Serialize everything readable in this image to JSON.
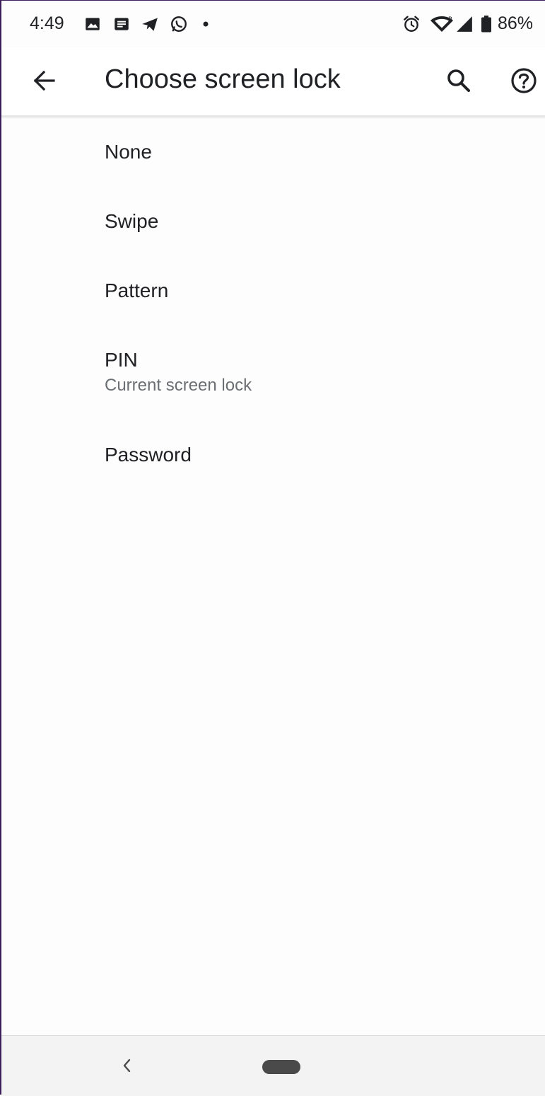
{
  "status_bar": {
    "time": "4:49",
    "battery_percent": "86%",
    "left_icons": [
      "image-icon",
      "message-icon",
      "telegram-icon",
      "whatsapp-icon",
      "dot-icon"
    ],
    "right_icons": [
      "alarm-icon",
      "wifi-icon",
      "signal-icon",
      "battery-icon"
    ]
  },
  "app_bar": {
    "title": "Choose screen lock",
    "back_icon": "back-arrow-icon",
    "search_icon": "search-icon",
    "help_icon": "help-icon"
  },
  "options": [
    {
      "title": "None"
    },
    {
      "title": "Swipe"
    },
    {
      "title": "Pattern"
    },
    {
      "title": "PIN",
      "summary": "Current screen lock"
    },
    {
      "title": "Password"
    }
  ],
  "nav_bar": {
    "back_icon": "nav-back-icon",
    "home_icon": "nav-home-pill"
  },
  "colors": {
    "background": "#fdfdfd",
    "text_primary": "#202124",
    "text_secondary": "#6b6e72",
    "nav_bar": "#f3f3f3"
  }
}
